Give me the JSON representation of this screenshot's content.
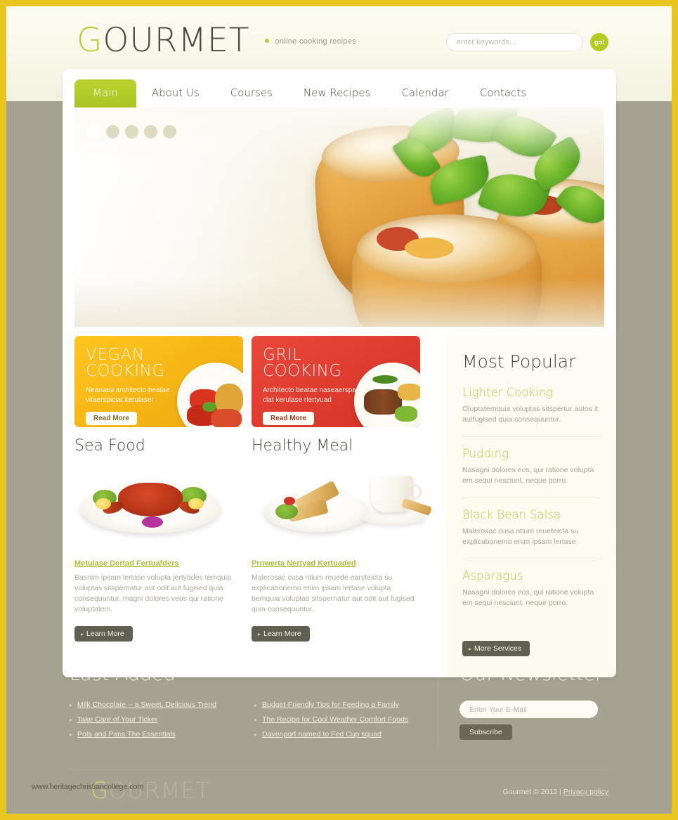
{
  "colors": {
    "accent_green": "#b3cc22",
    "border_gold": "#e8c51f",
    "banner_yellow": "#f5b515",
    "banner_red": "#de3b2e",
    "body_bg": "#a6a291",
    "dark_button": "#5f5f52"
  },
  "header": {
    "logo_first": "G",
    "logo_rest": "OURMET",
    "tagline": "online cooking recipes",
    "search": {
      "placeholder": "enter keywords...",
      "value": "",
      "button_label": "go!"
    }
  },
  "nav": {
    "items": [
      {
        "label": "Main",
        "active": true
      },
      {
        "label": "About Us",
        "active": false
      },
      {
        "label": "Courses",
        "active": false
      },
      {
        "label": "New Recipes",
        "active": false
      },
      {
        "label": "Calendar",
        "active": false
      },
      {
        "label": "Contacts",
        "active": false
      }
    ]
  },
  "slider": {
    "dots_total": 5,
    "active_dot": 1
  },
  "promos": [
    {
      "title_line1": "VEGAN",
      "title_line2": "COOKING",
      "text_line1": "Nearuasi architecto beatae",
      "text_line2": "vitaerspiciat kerulaser",
      "button": "Read More",
      "color": "#f5b515"
    },
    {
      "title_line1": "GRIL",
      "title_line2": "COOKING",
      "text_line1": "Architecto beatae naseaerspa",
      "text_line2": "clat kerulase rlertyuad",
      "button": "Read More",
      "color": "#de3b2e"
    }
  ],
  "articles": [
    {
      "heading": "Sea Food",
      "link": "Metulase Dertad Fertuafders",
      "text": "Basnim ipsam lertase volupta jertyades temquia voluptas sitspernatur aut odit aut fugised quia consequuntur. magni dolores veos qui ratione voluptatem.",
      "button": "Learn More"
    },
    {
      "heading": "Healthy Meal",
      "link": "Prnwerta Nertyad Kertuaded",
      "text": "Malerosac cusa ntium reuede earsteicta su explicabonemo enim ipsam lertase volupta bemquia voluptas sitspernatur aut odit aut fugised quia consequuntur.",
      "button": "Learn More"
    }
  ],
  "sidebar": {
    "heading": "Most Popular",
    "items": [
      {
        "title": "Lighter Cooking",
        "text": "Oluptatemquia voluptas sitspertur autos it autfugised quia consequuntur."
      },
      {
        "title": "Pudding",
        "text": "Nasagni dolores eos, qui ratione volupta em sequi nesciunt, neque porro."
      },
      {
        "title": "Black Bean Salsa",
        "text": "Malerosac cusa ntium reueteicta su explicabonemo enim ipsam lertase"
      },
      {
        "title": "Asparagus",
        "text": "Nasagni dolores eos, qui ratione volupta em sequi nesciunt, neque porro."
      }
    ],
    "button": "More Services"
  },
  "footer": {
    "last_added": {
      "heading": "Last Added",
      "column1": [
        "Milk Chocolate -- a Sweet, Delicious Trend",
        "Take Care of Your Ticker",
        "Pots and Pans:The Essentials"
      ],
      "column2": [
        "Budget-Friendly Tips for Feeding a Family",
        "The Recipe for Cool Weather Comfort Foods",
        "Davenport named to Fed Cup squad"
      ]
    },
    "newsletter": {
      "heading": "Our Newsletter",
      "placeholder": "Enter Your E-Mail",
      "value": "",
      "button": "Subscribe"
    },
    "logo_first": "G",
    "logo_rest": "OURMET",
    "watermark": "www.heritagechristiancollege.com",
    "copyright": "Gourmet © 2012  |  ",
    "privacy": "Privacy policy"
  }
}
